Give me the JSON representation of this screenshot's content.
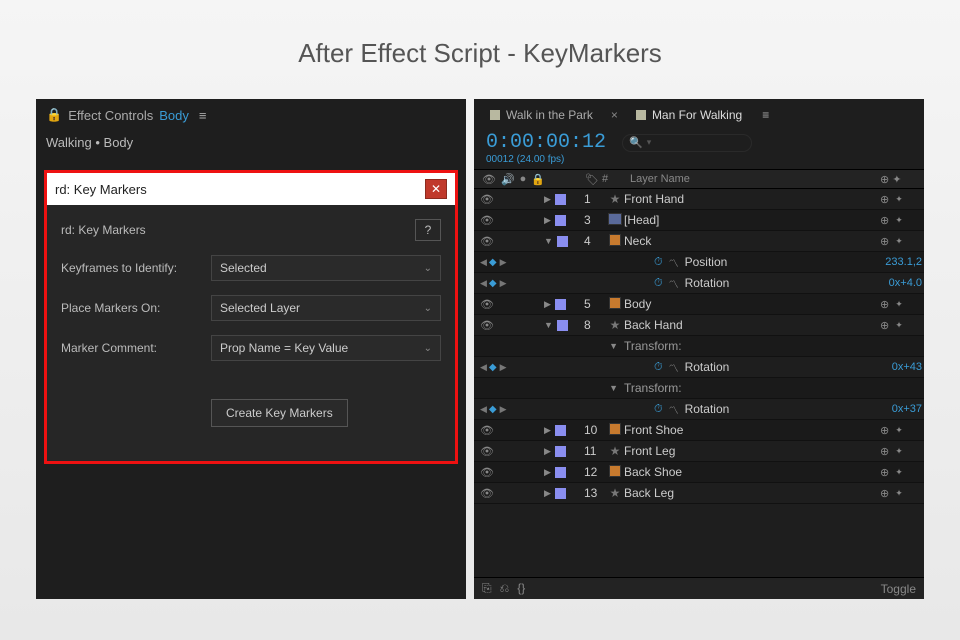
{
  "title": "After Effect Script - KeyMarkers",
  "effectControls": {
    "panelTitle": "Effect Controls",
    "layerLink": "Body",
    "breadcrumb": "Walking • Body"
  },
  "dialog": {
    "windowTitle": "rd: Key Markers",
    "heading": "rd: Key Markers",
    "help": "?",
    "rows": {
      "keyframes": {
        "label": "Keyframes to Identify:",
        "value": "Selected"
      },
      "place": {
        "label": "Place Markers On:",
        "value": "Selected Layer"
      },
      "comment": {
        "label": "Marker Comment:",
        "value": "Prop Name = Key Value"
      }
    },
    "createBtn": "Create Key Markers"
  },
  "timeline": {
    "tabs": {
      "t1": "Walk in the Park",
      "t2": "Man For Walking"
    },
    "timecode": "0:00:00:12",
    "frames": "00012 (24.00 fps)",
    "searchPlaceholder": "",
    "columns": {
      "hash": "#",
      "layerName": "Layer Name"
    },
    "rows": [
      {
        "idx": "1",
        "iconType": "star",
        "name": "Front Hand",
        "tail": true
      },
      {
        "idx": "3",
        "iconType": "head",
        "name": "[Head]",
        "tail": true
      },
      {
        "idx": "4",
        "iconType": "orange",
        "name": "Neck",
        "tail": true,
        "expanded": true
      },
      {
        "prop": "Position",
        "value": "233.1,2",
        "kf": true
      },
      {
        "prop": "Rotation",
        "value": "0x+4.0",
        "kf": true
      },
      {
        "idx": "5",
        "iconType": "orange",
        "name": "Body",
        "tail": true
      },
      {
        "idx": "8",
        "iconType": "star",
        "name": "Back Hand",
        "tail": true,
        "expanded": true
      },
      {
        "group": "Transform:"
      },
      {
        "prop": "Rotation",
        "value": "0x+43",
        "kf": true
      },
      {
        "group": "Transform:"
      },
      {
        "prop": "Rotation",
        "value": "0x+37",
        "kf": true
      },
      {
        "idx": "10",
        "iconType": "orange",
        "name": "Front Shoe",
        "tail": true
      },
      {
        "idx": "11",
        "iconType": "star",
        "name": "Front Leg",
        "tail": true
      },
      {
        "idx": "12",
        "iconType": "orange",
        "name": "Back Shoe",
        "tail": true
      },
      {
        "idx": "13",
        "iconType": "star",
        "name": "Back Leg",
        "tail": true
      }
    ],
    "footerRight": "Toggle"
  }
}
